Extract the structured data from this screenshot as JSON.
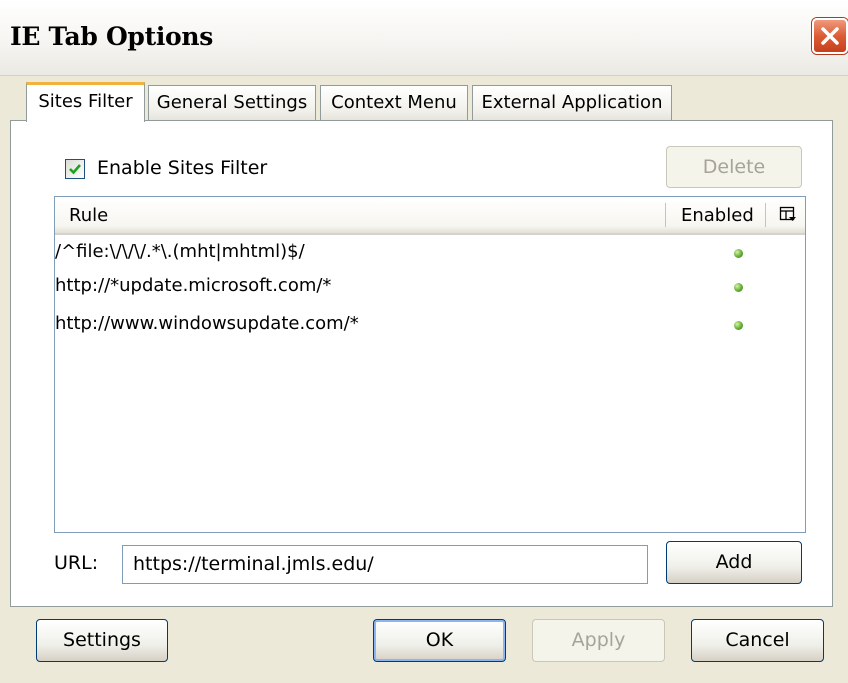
{
  "window": {
    "title": "IE Tab Options"
  },
  "tabs": [
    {
      "label": "Sites Filter",
      "active": true
    },
    {
      "label": "General Settings",
      "active": false
    },
    {
      "label": "Context Menu",
      "active": false
    },
    {
      "label": "External Application",
      "active": false
    }
  ],
  "sites_filter": {
    "enable_label": "Enable Sites Filter",
    "enable_checked": true,
    "delete_label": "Delete",
    "columns": {
      "rule": "Rule",
      "enabled": "Enabled"
    },
    "rules": [
      {
        "rule": "/^file:\\/\\/\\/.*\\.(mht|mhtml)$/",
        "enabled": true
      },
      {
        "rule": "http://*update.microsoft.com/*",
        "enabled": true
      },
      {
        "rule": "http://www.windowsupdate.com/*",
        "enabled": true
      }
    ],
    "url_label": "URL:",
    "url_value": "https://terminal.jmls.edu/",
    "add_label": "Add"
  },
  "footer": {
    "settings_label": "Settings",
    "ok_label": "OK",
    "apply_label": "Apply",
    "cancel_label": "Cancel"
  },
  "colors": {
    "enabled_dot": "#5aa832",
    "active_tab_accent": "#f0b33c"
  }
}
